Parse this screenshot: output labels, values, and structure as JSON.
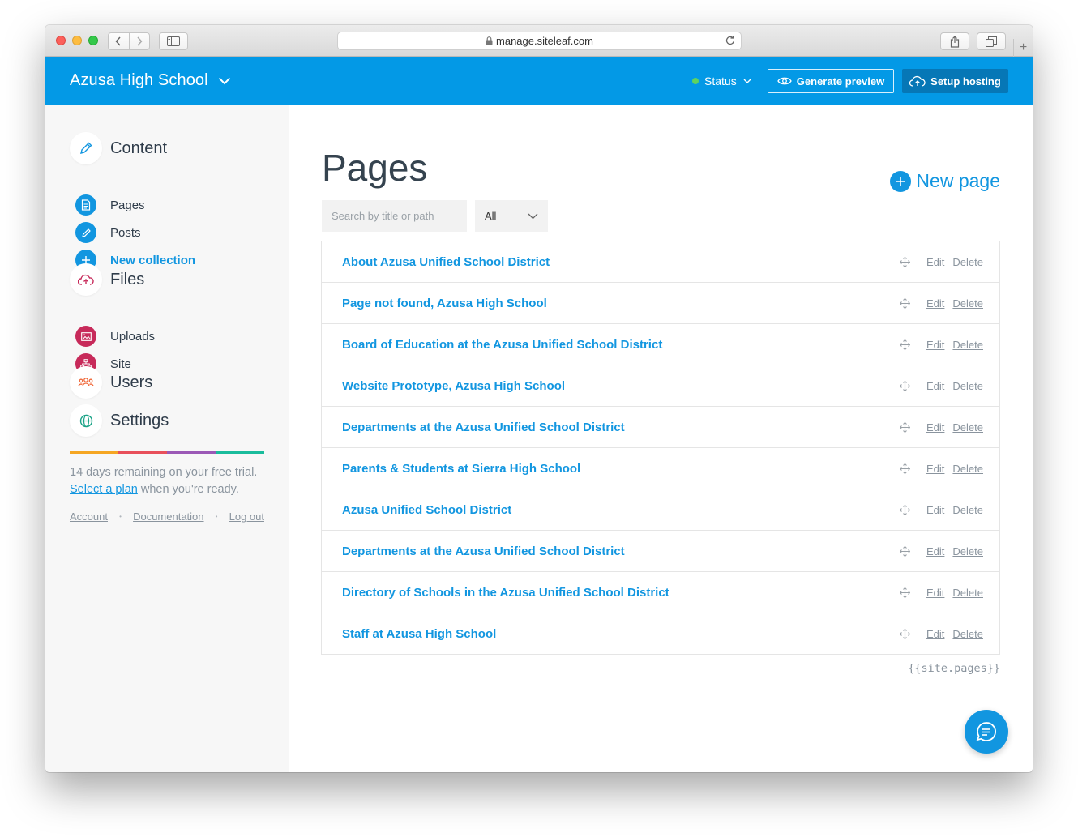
{
  "browser": {
    "url": "manage.siteleaf.com",
    "new_tab": "+"
  },
  "header": {
    "site_name": "Azusa High School",
    "status_label": "Status",
    "status_color": "#5fd35f",
    "preview_label": "Generate preview",
    "hosting_label": "Setup hosting",
    "accent_color": "#0399e6"
  },
  "sidebar": {
    "content": {
      "title": "Content",
      "items": [
        {
          "label": "Pages",
          "icon": "page-icon"
        },
        {
          "label": "Posts",
          "icon": "pencil-icon"
        }
      ],
      "new_collection": "New collection"
    },
    "files": {
      "title": "Files",
      "items": [
        {
          "label": "Uploads",
          "icon": "image-icon"
        },
        {
          "label": "Site",
          "icon": "sitemap-icon"
        }
      ]
    },
    "users": {
      "title": "Users"
    },
    "settings": {
      "title": "Settings"
    },
    "trial": {
      "text": "14 days remaining on your free trial.",
      "link": "Select a plan",
      "suffix": " when you're ready."
    },
    "footer": {
      "account": "Account",
      "documentation": "Documentation",
      "logout": "Log out",
      "separator": "•"
    }
  },
  "main": {
    "title": "Pages",
    "new_page": "New page",
    "search_placeholder": "Search by title or path",
    "filter_value": "All",
    "edit_label": "Edit",
    "delete_label": "Delete",
    "pages": [
      "About Azusa Unified School District",
      "Page not found, Azusa High School",
      "Board of Education at the Azusa Unified School District",
      "Website Prototype, Azusa High School",
      "Departments at the Azusa Unified School District",
      "Parents & Students at Sierra High School",
      "Azusa Unified School District",
      "Departments at the Azusa Unified School District",
      "Directory of Schools in the Azusa Unified School District",
      "Staff at Azusa High School"
    ],
    "template_var": "{{site.pages}}"
  }
}
